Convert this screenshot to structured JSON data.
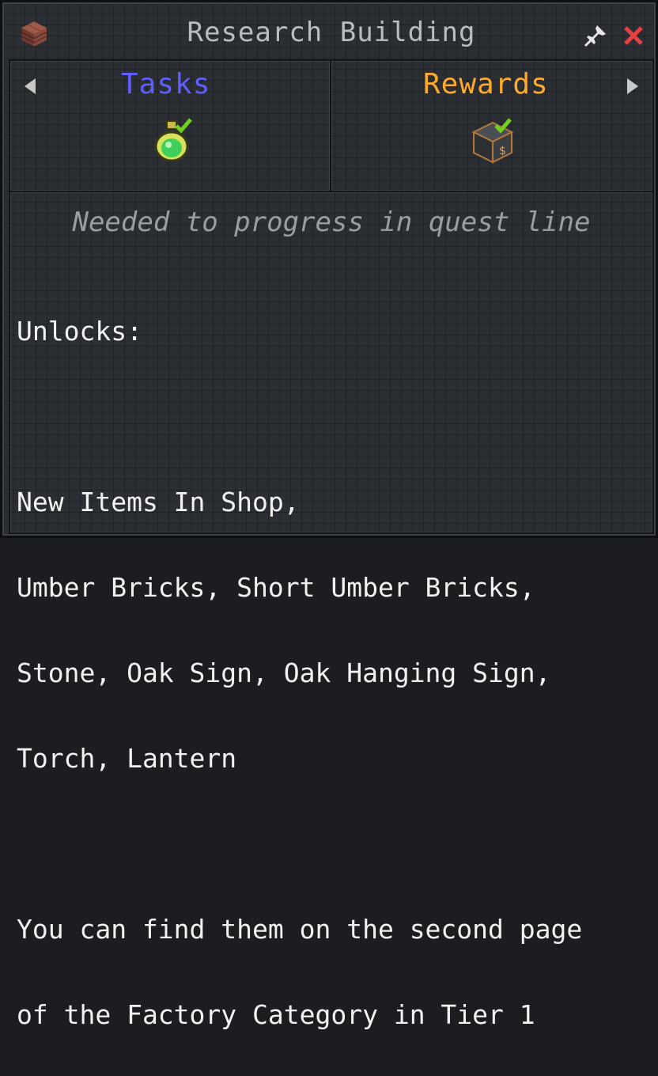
{
  "window": {
    "title": "Research Building",
    "icons": {
      "title_icon": "brick-block-icon",
      "pin": "pin-icon",
      "close": "close-icon"
    },
    "colors": {
      "close": "#e84040",
      "tasks": "#5f5fff",
      "rewards": "#ffaa2a",
      "checkmark": "#6fd11a"
    }
  },
  "tabs": {
    "tasks": {
      "label": "Tasks",
      "icon": "potion-bottle-icon",
      "completed": true
    },
    "rewards": {
      "label": "Rewards",
      "icon": "crate-icon",
      "completed": true
    },
    "prev_icon": "arrow-left-icon",
    "next_icon": "arrow-right-icon"
  },
  "description": {
    "subtitle": "Needed to progress in quest line",
    "heading": "Unlocks:",
    "items_header": "New Items In Shop,",
    "items_line1": "Umber Bricks, Short Umber Bricks,",
    "items_line2": "Stone, Oak Sign, Oak Hanging Sign,",
    "items_line3": "Torch, Lantern",
    "note_line1": "You can find them on the second page",
    "note_line2": "of the Factory Category in Tier 1"
  }
}
